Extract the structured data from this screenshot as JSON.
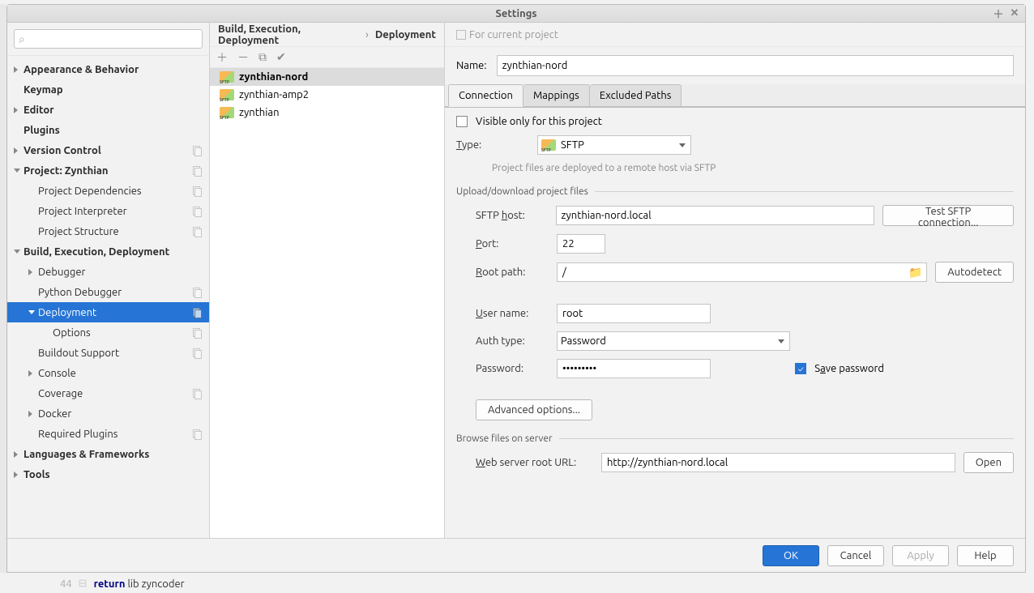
{
  "window": {
    "title": "Settings"
  },
  "sidebar": {
    "search_placeholder": "",
    "items": [
      {
        "label": "Appearance & Behavior",
        "bold": true,
        "arrow": "collapsed",
        "lvl": 1
      },
      {
        "label": "Keymap",
        "bold": true,
        "lvl": 1
      },
      {
        "label": "Editor",
        "bold": true,
        "arrow": "collapsed",
        "lvl": 1
      },
      {
        "label": "Plugins",
        "bold": true,
        "lvl": 1
      },
      {
        "label": "Version Control",
        "bold": true,
        "arrow": "collapsed",
        "lvl": 1,
        "copy": true
      },
      {
        "label": "Project: Zynthian",
        "bold": true,
        "arrow": "expanded",
        "lvl": 1,
        "copy": true
      },
      {
        "label": "Project Dependencies",
        "lvl": 2,
        "copy": true
      },
      {
        "label": "Project Interpreter",
        "lvl": 2,
        "copy": true
      },
      {
        "label": "Project Structure",
        "lvl": 2,
        "copy": true
      },
      {
        "label": "Build, Execution, Deployment",
        "bold": true,
        "arrow": "expanded",
        "lvl": 1
      },
      {
        "label": "Debugger",
        "lvl": 2,
        "arrow": "collapsed"
      },
      {
        "label": "Python Debugger",
        "lvl": 2,
        "copy": true
      },
      {
        "label": "Deployment",
        "lvl": 2,
        "arrow": "expanded",
        "selected": true,
        "copy": true
      },
      {
        "label": "Options",
        "lvl": 3,
        "copy": true
      },
      {
        "label": "Buildout Support",
        "lvl": 2,
        "copy": true
      },
      {
        "label": "Console",
        "lvl": 2,
        "arrow": "collapsed"
      },
      {
        "label": "Coverage",
        "lvl": 2,
        "copy": true
      },
      {
        "label": "Docker",
        "lvl": 2,
        "arrow": "collapsed"
      },
      {
        "label": "Required Plugins",
        "lvl": 2,
        "copy": true
      },
      {
        "label": "Languages & Frameworks",
        "bold": true,
        "arrow": "collapsed",
        "lvl": 1
      },
      {
        "label": "Tools",
        "bold": true,
        "arrow": "collapsed",
        "lvl": 1
      }
    ]
  },
  "breadcrumb": {
    "a": "Build, Execution, Deployment",
    "b": "Deployment",
    "hint": "For current project"
  },
  "servers": [
    {
      "name": "zynthian-nord",
      "selected": true
    },
    {
      "name": "zynthian-amp2"
    },
    {
      "name": "zynthian"
    }
  ],
  "form": {
    "name_label": "Name:",
    "name_value": "zynthian-nord",
    "tabs": [
      "Connection",
      "Mappings",
      "Excluded Paths"
    ],
    "active_tab": "Connection",
    "visible_only": "Visible only for this project",
    "type_label": "Type:",
    "type_value": "SFTP",
    "type_hint": "Project files are deployed to a remote host via SFTP",
    "upload_section": "Upload/download project files",
    "host_label": "SFTP host:",
    "host_value": "zynthian-nord.local",
    "test_btn": "Test SFTP connection...",
    "port_label": "Port:",
    "port_value": "22",
    "root_label": "Root path:",
    "root_value": "/",
    "autodetect_btn": "Autodetect",
    "user_label": "User name:",
    "user_value": "root",
    "auth_label": "Auth type:",
    "auth_value": "Password",
    "pass_label": "Password:",
    "pass_value": "•••••••••",
    "save_pass_label": "Save password",
    "adv_btn": "Advanced options...",
    "browse_section": "Browse files on server",
    "web_label": "Web server root URL:",
    "web_value": "http://zynthian-nord.local",
    "open_btn": "Open"
  },
  "footer": {
    "ok": "OK",
    "cancel": "Cancel",
    "apply": "Apply",
    "help": "Help"
  },
  "editor": {
    "line_no": "44",
    "kw": "return",
    "rest": "lib zyncoder"
  }
}
